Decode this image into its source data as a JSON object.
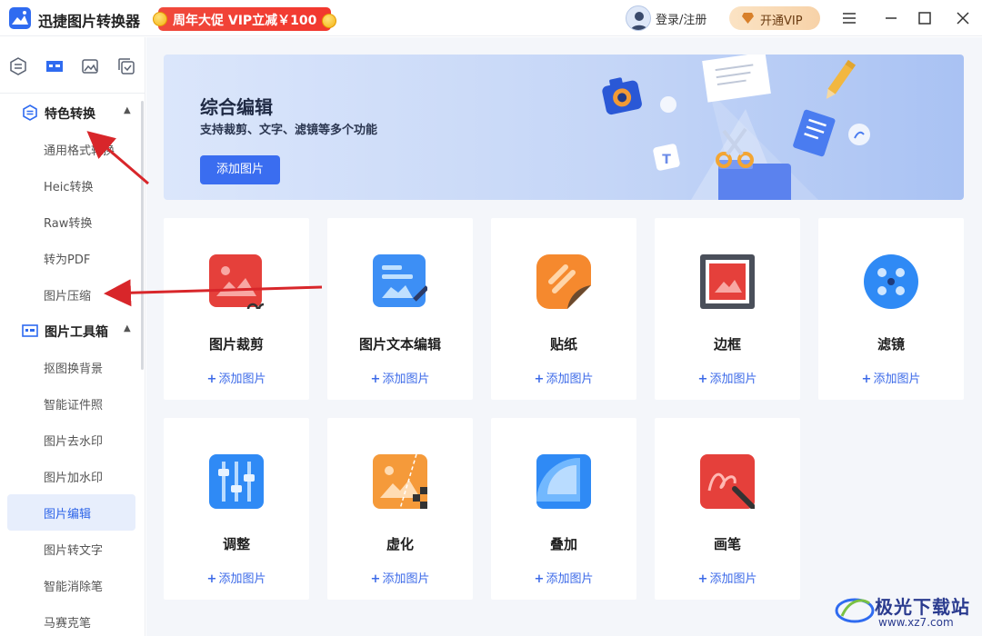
{
  "app": {
    "title": "迅捷图片转换器",
    "promo": "周年大促 VIP立减￥100",
    "login": "登录/注册",
    "vip": "开通VIP"
  },
  "sidebar": {
    "groups": [
      {
        "label": "特色转换",
        "items": [
          "通用格式转换",
          "Heic转换",
          "Raw转换",
          "转为PDF",
          "图片压缩"
        ]
      },
      {
        "label": "图片工具箱",
        "items": [
          "抠图换背景",
          "智能证件照",
          "图片去水印",
          "图片加水印",
          "图片编辑",
          "图片转文字",
          "智能消除笔",
          "马赛克笔"
        ]
      }
    ],
    "active_item": "图片编辑"
  },
  "banner": {
    "title": "综合编辑",
    "subtitle": "支持裁剪、文字、滤镜等多个功能",
    "button": "添加图片"
  },
  "cards": [
    {
      "title": "图片裁剪",
      "add": "添加图片",
      "icon": "crop-icon"
    },
    {
      "title": "图片文本编辑",
      "add": "添加图片",
      "icon": "text-edit-icon"
    },
    {
      "title": "贴纸",
      "add": "添加图片",
      "icon": "sticker-icon"
    },
    {
      "title": "边框",
      "add": "添加图片",
      "icon": "frame-icon"
    },
    {
      "title": "滤镜",
      "add": "添加图片",
      "icon": "filter-icon"
    },
    {
      "title": "调整",
      "add": "添加图片",
      "icon": "adjust-icon"
    },
    {
      "title": "虚化",
      "add": "添加图片",
      "icon": "blur-icon"
    },
    {
      "title": "叠加",
      "add": "添加图片",
      "icon": "overlay-icon"
    },
    {
      "title": "画笔",
      "add": "添加图片",
      "icon": "brush-icon"
    }
  ],
  "watermark": {
    "name": "极光下载站",
    "url": "www.xz7.com"
  },
  "colors": {
    "accent": "#3a6df0",
    "active_bg": "#e7eefc",
    "promo": "#f2372e",
    "arrow": "#d8262a"
  }
}
